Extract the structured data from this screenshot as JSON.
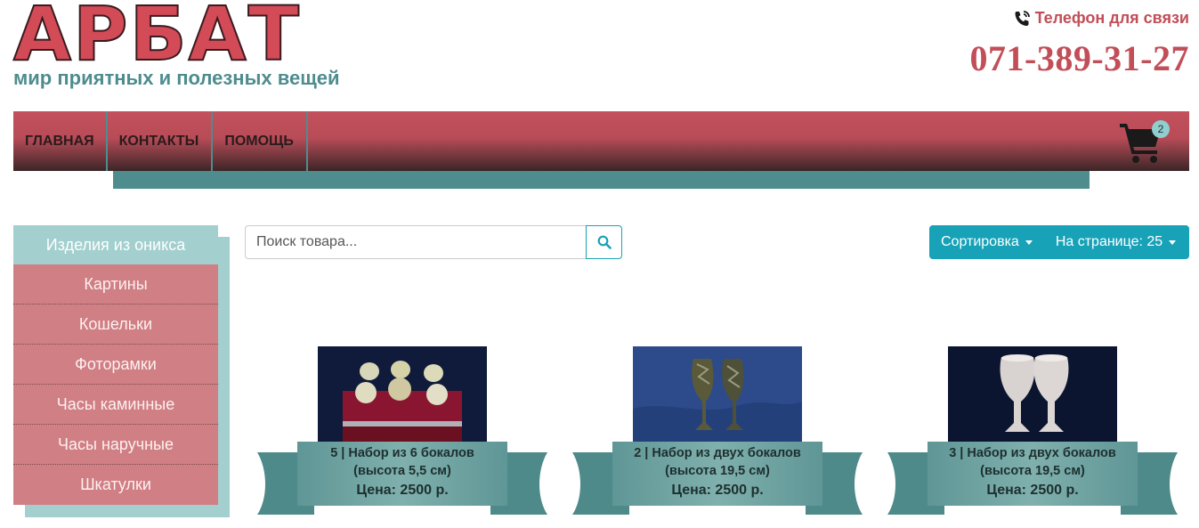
{
  "header": {
    "logo_text": "АРБАТ",
    "tagline": "мир приятных и полезных вещей",
    "phone_label": "Телефон для связи",
    "phone_number": "071-389-31-27",
    "phone_icon": "phone-icon"
  },
  "nav": {
    "items": [
      "ГЛАВНАЯ",
      "КОНТАКТЫ",
      "ПОМОЩЬ"
    ],
    "cart_icon": "cart-icon",
    "cart_count": "2"
  },
  "sidebar": {
    "header": "Изделия из оникса",
    "items": [
      "Картины",
      "Кошельки",
      "Фоторамки",
      "Часы каминные",
      "Часы наручные",
      "Шкатулки"
    ]
  },
  "search": {
    "placeholder": "Поиск товара...",
    "button_icon": "search-icon"
  },
  "toolbar": {
    "sort_label": "Сортировка",
    "per_page_label": "На странице: 25"
  },
  "products": [
    {
      "title_line1": "5 | Набор из 6 бокалов",
      "title_line2": "(высота 5,5 см)",
      "price": "Цена: 2500 р."
    },
    {
      "title_line1": "2 | Набор из двух бокалов",
      "title_line2": "(высота 19,5 см)",
      "price": "Цена: 2500 р."
    },
    {
      "title_line1": "3 | Набор из двух бокалов",
      "title_line2": "(высота 19,5 см)",
      "price": "Цена: 2500 р."
    }
  ],
  "colors": {
    "brand_red": "#c24e58",
    "teal": "#4e8c8e",
    "toolbar_blue": "#17a2b8",
    "sidebar_pink": "#d07f84",
    "sidebar_head": "#a3cfcf"
  }
}
